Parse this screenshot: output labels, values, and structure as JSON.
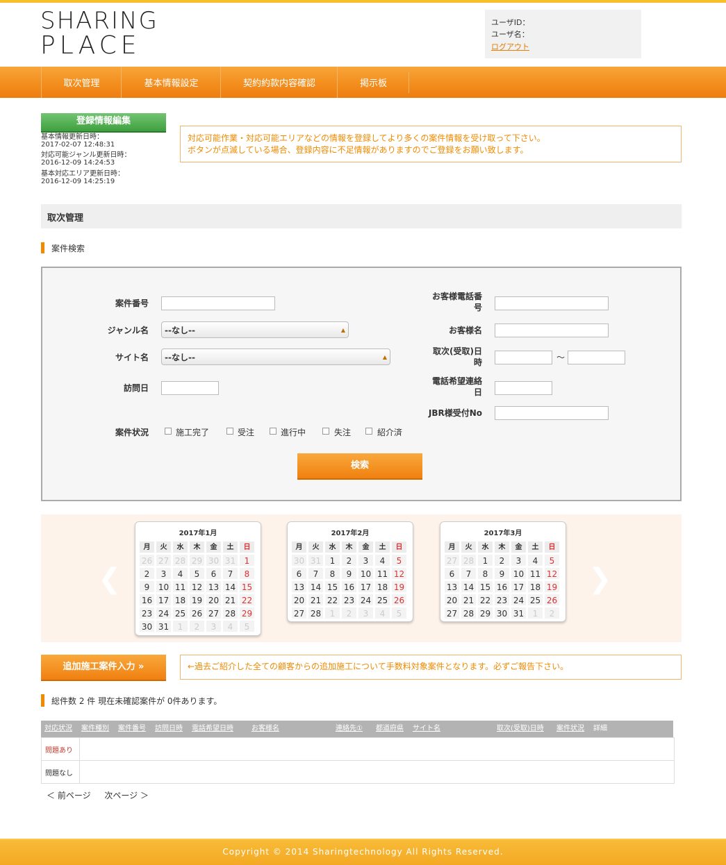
{
  "logo": {
    "line1": "SHARING",
    "line2": "PLACE"
  },
  "user": {
    "id_label": "ユーザID：",
    "name_label": "ユーザ名：",
    "logout": "ログアウト"
  },
  "nav": {
    "items": [
      "取次管理",
      "基本情報設定",
      "契約約款内容確認",
      "掲示板"
    ]
  },
  "sidebar": {
    "edit_button": "登録情報編集",
    "updates": [
      {
        "label": "基本情報更新日時：",
        "value": "2017-02-07 12:48:31"
      },
      {
        "label": "対応可能ジャンル更新日時：",
        "value": "2016-12-09 14:24:53"
      },
      {
        "label": "基本対応エリア更新日時：",
        "value": "2016-12-09 14:25:19"
      }
    ]
  },
  "notice1": {
    "line1": "対応可能作業・対応可能エリアなどの情報を登録してより多くの案件情報を受け取って下さい。",
    "line2": "ボタンが点滅している場合、登録内容に不足情報がありますのでご登録をお願い致します。"
  },
  "section_title": "取次管理",
  "search_heading": "案件検索",
  "search": {
    "case_number": "案件番号",
    "genre": "ジャンル名",
    "genre_value": "--なし--",
    "site": "サイト名",
    "site_value": "--なし--",
    "visit_date": "訪問日",
    "phone_l1": "お客様電話番",
    "phone_l2": "号",
    "customer_name": "お客様名",
    "handled_l1": "取次(受取)日",
    "handled_l2": "時",
    "tilde": "～",
    "contact_l1": "電話希望連絡",
    "contact_l2": "日",
    "jbr": "JBR様受付No",
    "status_label": "案件状況",
    "statuses": [
      "施工完了",
      "受注",
      "進行中",
      "失注",
      "紹介済"
    ],
    "submit": "検索"
  },
  "calendar": {
    "weekdays": [
      "月",
      "火",
      "水",
      "木",
      "金",
      "土",
      "日"
    ],
    "months": [
      {
        "title": "2017年1月",
        "days": [
          "26",
          "27",
          "28",
          "29",
          "30",
          "31",
          "1",
          "2",
          "3",
          "4",
          "5",
          "6",
          "7",
          "8",
          "9",
          "10",
          "11",
          "12",
          "13",
          "14",
          "15",
          "16",
          "17",
          "18",
          "19",
          "20",
          "21",
          "22",
          "23",
          "24",
          "25",
          "26",
          "27",
          "28",
          "29",
          "30",
          "31",
          "1",
          "2",
          "3",
          "4",
          "5"
        ],
        "first": 6,
        "count": 31
      },
      {
        "title": "2017年2月",
        "days": [
          "30",
          "31",
          "1",
          "2",
          "3",
          "4",
          "5",
          "6",
          "7",
          "8",
          "9",
          "10",
          "11",
          "12",
          "13",
          "14",
          "15",
          "16",
          "17",
          "18",
          "19",
          "20",
          "21",
          "22",
          "23",
          "24",
          "25",
          "26",
          "27",
          "28",
          "1",
          "2",
          "3",
          "4",
          "5"
        ],
        "first": 2,
        "count": 28
      },
      {
        "title": "2017年3月",
        "days": [
          "27",
          "28",
          "1",
          "2",
          "3",
          "4",
          "5",
          "6",
          "7",
          "8",
          "9",
          "10",
          "11",
          "12",
          "13",
          "14",
          "15",
          "16",
          "17",
          "18",
          "19",
          "20",
          "21",
          "22",
          "23",
          "24",
          "25",
          "26",
          "27",
          "28",
          "29",
          "30",
          "31",
          "1",
          "2"
        ],
        "first": 2,
        "count": 31
      }
    ]
  },
  "add_button": "追加施工案件入力 »",
  "notice2": "←過去ご紹介した全ての顧客からの追加施工について手数料対象案件となります。必ずご報告下さい。",
  "total_text": "総件数 2 件 現在未確認案件が 0件あります。",
  "table": {
    "headers": [
      "対応状況",
      "案件種別",
      "案件番号",
      "訪問日時",
      "電話希望日時",
      "お客様名",
      "連絡先①",
      "都道府県",
      "サイト名",
      "取次(受取)日時",
      "案件状況",
      "詳細"
    ],
    "rows": [
      {
        "status": "問題あり",
        "status_color": "#c0392b"
      },
      {
        "status": "問題なし",
        "status_color": "#333333"
      }
    ]
  },
  "pager": {
    "prev": "＜ 前ページ",
    "next": "次ページ ＞"
  },
  "footer": "Copyright © 2014 Sharingtechnology All Rights Reserved."
}
